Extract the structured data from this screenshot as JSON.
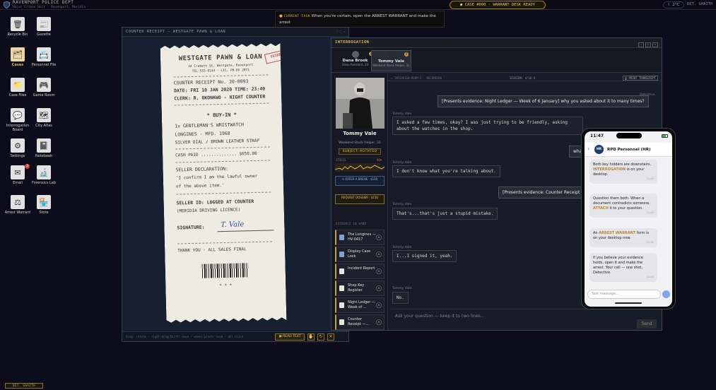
{
  "topbar": {
    "dept": "RAVENPORT POLICE DEPT",
    "unit": "Major Crimes Unit · Ravenport, Meridia",
    "case_pill": "● CASE #000 · WARRANT DESK READY",
    "weather": "☾ 2°C",
    "detective": "DET. GHAITH"
  },
  "current_task": {
    "label": "CURRENT TASK",
    "text": "When you're certain, open the ARREST WARRANT and make the arrest"
  },
  "desktop_icons": [
    {
      "label": "Recycle Bin",
      "icon": "🗑"
    },
    {
      "label": "Gazette",
      "icon": "📰"
    },
    {
      "label": "Cases",
      "icon": "🗂"
    },
    {
      "label": "Personnel File",
      "icon": "📇"
    },
    {
      "label": "Case Files",
      "icon": "📁"
    },
    {
      "label": "Game Room",
      "icon": "🎮"
    },
    {
      "label": "Interrogation Board",
      "icon": "💬"
    },
    {
      "label": "City Atlas",
      "icon": "🗺"
    },
    {
      "label": "Settings",
      "icon": "⚙"
    },
    {
      "label": "Notebook",
      "icon": "📓"
    },
    {
      "label": "Email",
      "icon": "✉",
      "badge": "3"
    },
    {
      "label": "Forensics Lab",
      "icon": "🔬"
    },
    {
      "label": "Arrest Warrant",
      "icon": "⚖"
    },
    {
      "label": "Store",
      "icon": "🏪"
    }
  ],
  "receipt_window": {
    "title": "COUNTER RECEIPT — WESTGATE PAWN & LOAN",
    "hint": "Drag: rotate · right-drag/Shift: move · wheel/pinch: zoom · dbl-click",
    "read_text": "▣ READ TEXT",
    "receipt": {
      "store": "WESTGATE PAWN & LOAN",
      "stamp": "EVIDENCE",
      "address": "44 Crabett St, Westgate, Ravenport",
      "tel": "TEL 555-0144 · LIC. PB-RV 2071",
      "receipt_no": "COUNTER RECEIPT No. 20-0093",
      "date": "DATE: FRI 10 JAN 2020   TIME: 23:40",
      "clerk": "CLERK: R. OKONKWO - NIGHT COUNTER",
      "buy_in": "* BUY-IN *",
      "item1": "1x GENTLEMAN'S WRISTWATCH",
      "item2": "LONGINES - MFD. 1968",
      "item3": "SILVER DIAL / BROWN LEATHER STRAP",
      "cash": "CASH PAID .............. $650.00",
      "decl": "SELLER DECLARATION:",
      "decl1": "'I confirm I am the lawful owner",
      "decl2": "of the above item.'",
      "seller_id": "SELLER ID: LOGGED AT COUNTER",
      "seller_id2": "(MERIDIA DRIVING LICENCE)",
      "signature_label": "SIGNATURE:",
      "signature": "T. Vale",
      "thanks": "THANK YOU - ALL SALES FINAL",
      "stars": "* * *"
    }
  },
  "interrogation": {
    "title": "INTERROGATION",
    "tabs": [
      {
        "name": "Dana Brook",
        "role": "Shop Assistant, 24",
        "badge": "2"
      },
      {
        "name": "Tommy Vale",
        "role": "Weekend Stock Helper, 31",
        "badge": "4"
      }
    ],
    "suspect": {
      "name": "Tommy Vale",
      "role": "Weekend Stock Helper, 31",
      "status": "SUBJECT: AGITATED",
      "stress_label": "STRESS",
      "stress_value": "90%",
      "offer": "✎ OFFER A BREAK · $100",
      "request": "REQUEST DOSSIER · $150"
    },
    "evidence_header": "EVIDENCE IN HAND",
    "evidence": [
      "The Longines — HV-0417",
      "Display Case Lock",
      "Incident Report",
      "Shop Key Register",
      "Night Ledger — Week of ...",
      "Counter Receipt —..."
    ],
    "chat_header_left": "◂ INTERVIEW ROOM 2 · RECORDING",
    "chat_header_mid": "SESSION: 4/10 Q",
    "chat_header_right": "⎙ PRINT TRANSCRIPT",
    "messages": [
      {
        "speaker": "Detective",
        "text": "[Presents evidence: Night Ledger — Week of 6 January] why you asked about it to many times?"
      },
      {
        "speaker": "Tommy Vale",
        "text": "I asked a few times, okay? I was just trying to be friendly, asking about the watches in the shop."
      },
      {
        "speaker": "",
        "text": "wha"
      },
      {
        "speaker": "Tommy Vale",
        "text": "I don't know what you're talking about."
      },
      {
        "speaker": "",
        "text": "[Presents evidence: Counter Receipt"
      },
      {
        "speaker": "Tommy Vale",
        "text": "That's...that's just a stupid mistake."
      },
      {
        "speaker": "Tommy Vale",
        "text": "I...I signed it, yeah."
      },
      {
        "speaker": "Tommy Vale",
        "text": "No."
      }
    ],
    "ask_placeholder": "Ask your question — keep it to two lines...",
    "send": "Send"
  },
  "phone": {
    "time": "11:47",
    "contact": "RPD Personnel (HR)",
    "avatar": "HR",
    "messages": [
      {
        "pre": "Both key holders are downstairs. ",
        "hl": "INTERROGATION",
        "post": " is on your desktop.",
        "time": "11:45"
      },
      {
        "pre": "Question them both. When a document contradicts someone, ",
        "hl": "ATTACH",
        "post": " it to your question.",
        "time": "11:45"
      },
      {
        "pre": "An ",
        "hl": "ARREST WARRANT",
        "post": " form is on your desktop now.",
        "time": "11:45"
      },
      {
        "pre": "If you believe your evidence holds, open it and make the arrest. Your call — one shot, Detective.",
        "hl": "",
        "post": "",
        "time": "11:45"
      }
    ],
    "input_placeholder": "Text message..."
  },
  "bottom": {
    "det_button": "DET. GHAITH"
  }
}
